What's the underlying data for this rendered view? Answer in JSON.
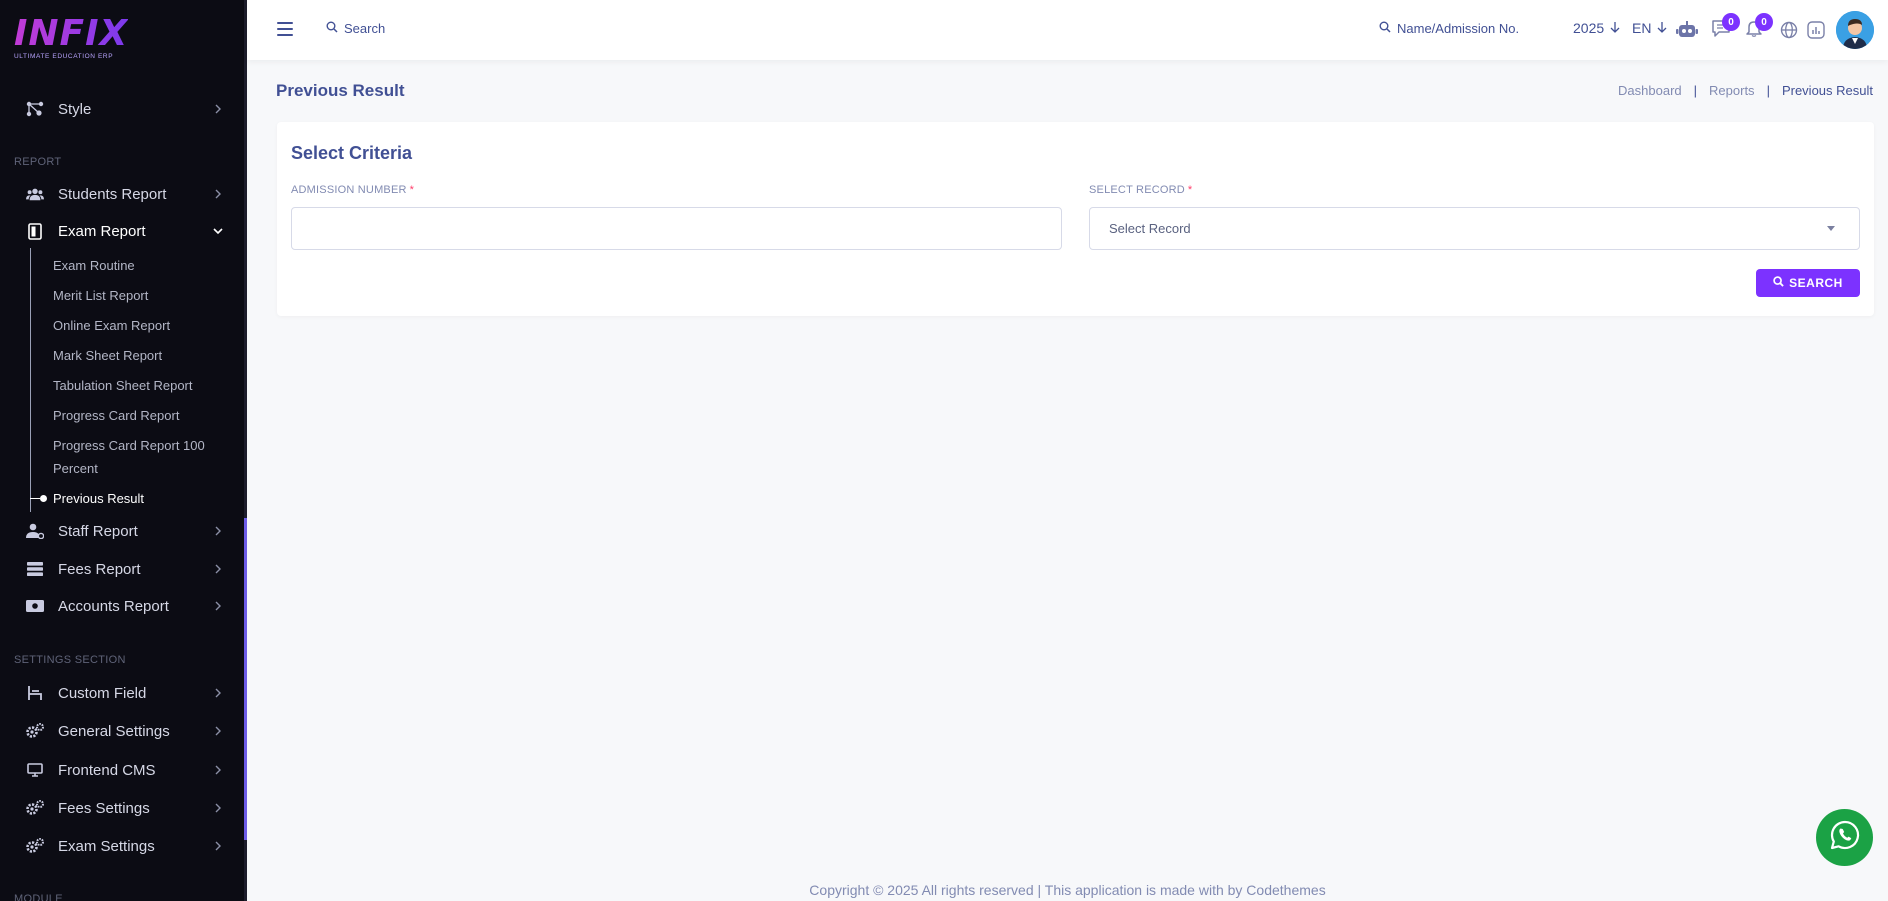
{
  "brand": {
    "name": "INFIX",
    "tagline": "ULTIMATE EDUCATION ERP"
  },
  "sidebar": {
    "style_item": {
      "label": "Style"
    },
    "report_section": "REPORT",
    "report_items": [
      {
        "label": "Students Report"
      },
      {
        "label": "Exam Report"
      },
      {
        "label": "Staff Report"
      },
      {
        "label": "Fees Report"
      },
      {
        "label": "Accounts Report"
      }
    ],
    "exam_sub_items": [
      "Exam Routine",
      "Merit List Report",
      "Online Exam Report",
      "Mark Sheet Report",
      "Tabulation Sheet Report",
      "Progress Card Report",
      "Progress Card Report 100 Percent",
      "Previous Result"
    ],
    "settings_section": "SETTINGS SECTION",
    "settings_items": [
      {
        "label": "Custom Field"
      },
      {
        "label": "General Settings"
      },
      {
        "label": "Frontend CMS"
      },
      {
        "label": "Fees Settings"
      },
      {
        "label": "Exam Settings"
      }
    ],
    "module_section": "MODULE"
  },
  "header": {
    "search_label": "Search",
    "name_search_label": "Name/Admission No.",
    "year": "2025",
    "language": "EN",
    "chat_badge": "0",
    "notification_badge": "0"
  },
  "page": {
    "title": "Previous Result",
    "breadcrumb": [
      "Dashboard",
      "Reports",
      "Previous Result"
    ]
  },
  "criteria": {
    "title": "Select Criteria",
    "admission_label": "ADMISSION NUMBER",
    "admission_value": "",
    "record_label": "SELECT RECORD",
    "record_placeholder": "Select Record",
    "required_mark": "*",
    "search_button": "SEARCH"
  },
  "footer": {
    "text": "Copyright © 2025 All rights reserved | This application is made with by Codethemes"
  },
  "colors": {
    "accent": "#7c32ff",
    "text": "#415094",
    "sidebar_bg": "#0c0c14",
    "whatsapp": "#1ba245"
  }
}
